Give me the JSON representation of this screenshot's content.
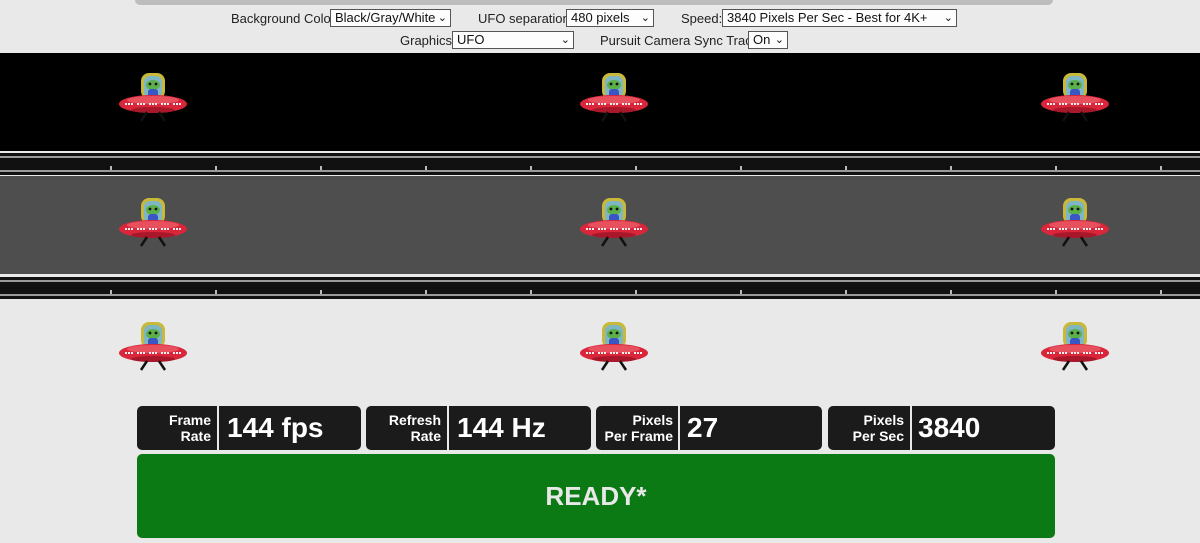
{
  "controls": {
    "background_color": {
      "label": "Background Color:",
      "value": "Black/Gray/White"
    },
    "ufo_separation": {
      "label": "UFO separation:",
      "value": "480 pixels"
    },
    "speed": {
      "label": "Speed:",
      "value": "3840 Pixels Per Sec - Best for 4K+"
    },
    "graphics": {
      "label": "Graphics:",
      "value": "UFO"
    },
    "pursuit_camera": {
      "label": "Pursuit Camera Sync Track:",
      "value": "On"
    }
  },
  "lanes": [
    "black",
    "gray",
    "white"
  ],
  "stats": {
    "frame_rate": {
      "label_line1": "Frame",
      "label_line2": "Rate",
      "value": "144 fps"
    },
    "refresh_rate": {
      "label_line1": "Refresh",
      "label_line2": "Rate",
      "value": "144 Hz"
    },
    "pixels_per_frame": {
      "label_line1": "Pixels",
      "label_line2": "Per Frame",
      "value": "27"
    },
    "pixels_per_sec": {
      "label_line1": "Pixels",
      "label_line2": "Per Sec",
      "value": "3840"
    }
  },
  "status": {
    "label": "READY*",
    "color": "#0b7a14"
  },
  "icons": {
    "ufo": "ufo-alien-icon",
    "chevron": "chevron-down-icon"
  }
}
